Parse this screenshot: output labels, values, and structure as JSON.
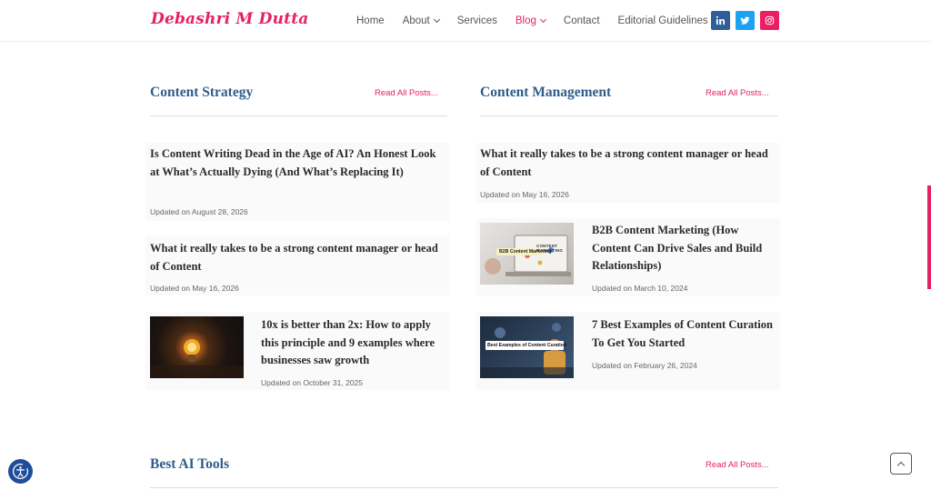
{
  "site": {
    "logo": "Debashri M Dutta"
  },
  "nav": {
    "items": [
      {
        "label": "Home",
        "dropdown": false,
        "active": false
      },
      {
        "label": "About",
        "dropdown": true,
        "active": false
      },
      {
        "label": "Services",
        "dropdown": false,
        "active": false
      },
      {
        "label": "Blog",
        "dropdown": true,
        "active": true
      },
      {
        "label": "Contact",
        "dropdown": false,
        "active": false
      },
      {
        "label": "Editorial Guidelines",
        "dropdown": false,
        "active": false
      }
    ],
    "social": [
      "linkedin-icon",
      "twitter-icon",
      "instagram-icon"
    ]
  },
  "colors": {
    "accent": "#e6215f",
    "heading": "#2f5d8a",
    "linkedin": "#2f5d9a",
    "twitter": "#1da1f2",
    "instagram": "#e91e63"
  },
  "sections": [
    {
      "title": "Content Strategy",
      "read_all": "Read All Posts...",
      "posts": [
        {
          "title": "Is Content Writing Dead in the Age of AI? An Honest Look at What’s Actually Dying (And What’s Replacing It)",
          "date": "Updated on August 28, 2026"
        },
        {
          "title": "What it really takes to be a strong content manager or head of Content",
          "date": "Updated on May 16, 2026"
        },
        {
          "title": "10x is better than 2x: How to apply this principle and 9 examples where businesses saw growth",
          "date": "Updated on October 31, 2025"
        }
      ]
    },
    {
      "title": "Content Management",
      "read_all": "Read All Posts...",
      "posts": [
        {
          "title": "What it really takes to be a strong content manager or head of Content",
          "date": "Updated on May 16, 2026"
        },
        {
          "title": "B2B Content Marketing (How Content Can Drive Sales and Build Relationships)",
          "date": "Updated on March 10, 2024",
          "thumb_caption": "B2B Content Marketing",
          "thumb_heading": "CONTENT MARKETING"
        },
        {
          "title": "7 Best Examples of Content Curation To Get You Started",
          "date": "Updated on February 26, 2024",
          "thumb_caption": "Best Examples of Content Curation"
        }
      ]
    },
    {
      "title": "Best AI Tools",
      "read_all": "Read All Posts..."
    }
  ]
}
